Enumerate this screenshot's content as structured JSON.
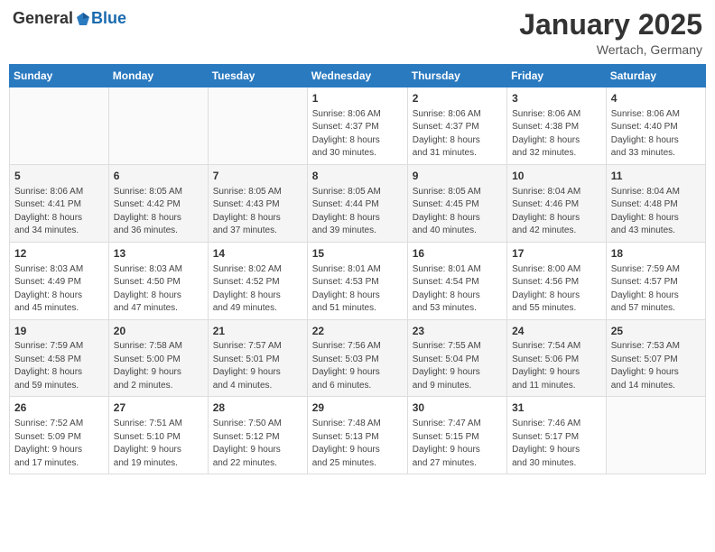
{
  "header": {
    "logo_general": "General",
    "logo_blue": "Blue",
    "month": "January 2025",
    "location": "Wertach, Germany"
  },
  "weekdays": [
    "Sunday",
    "Monday",
    "Tuesday",
    "Wednesday",
    "Thursday",
    "Friday",
    "Saturday"
  ],
  "weeks": [
    [
      {
        "day": "",
        "info": ""
      },
      {
        "day": "",
        "info": ""
      },
      {
        "day": "",
        "info": ""
      },
      {
        "day": "1",
        "info": "Sunrise: 8:06 AM\nSunset: 4:37 PM\nDaylight: 8 hours\nand 30 minutes."
      },
      {
        "day": "2",
        "info": "Sunrise: 8:06 AM\nSunset: 4:37 PM\nDaylight: 8 hours\nand 31 minutes."
      },
      {
        "day": "3",
        "info": "Sunrise: 8:06 AM\nSunset: 4:38 PM\nDaylight: 8 hours\nand 32 minutes."
      },
      {
        "day": "4",
        "info": "Sunrise: 8:06 AM\nSunset: 4:40 PM\nDaylight: 8 hours\nand 33 minutes."
      }
    ],
    [
      {
        "day": "5",
        "info": "Sunrise: 8:06 AM\nSunset: 4:41 PM\nDaylight: 8 hours\nand 34 minutes."
      },
      {
        "day": "6",
        "info": "Sunrise: 8:05 AM\nSunset: 4:42 PM\nDaylight: 8 hours\nand 36 minutes."
      },
      {
        "day": "7",
        "info": "Sunrise: 8:05 AM\nSunset: 4:43 PM\nDaylight: 8 hours\nand 37 minutes."
      },
      {
        "day": "8",
        "info": "Sunrise: 8:05 AM\nSunset: 4:44 PM\nDaylight: 8 hours\nand 39 minutes."
      },
      {
        "day": "9",
        "info": "Sunrise: 8:05 AM\nSunset: 4:45 PM\nDaylight: 8 hours\nand 40 minutes."
      },
      {
        "day": "10",
        "info": "Sunrise: 8:04 AM\nSunset: 4:46 PM\nDaylight: 8 hours\nand 42 minutes."
      },
      {
        "day": "11",
        "info": "Sunrise: 8:04 AM\nSunset: 4:48 PM\nDaylight: 8 hours\nand 43 minutes."
      }
    ],
    [
      {
        "day": "12",
        "info": "Sunrise: 8:03 AM\nSunset: 4:49 PM\nDaylight: 8 hours\nand 45 minutes."
      },
      {
        "day": "13",
        "info": "Sunrise: 8:03 AM\nSunset: 4:50 PM\nDaylight: 8 hours\nand 47 minutes."
      },
      {
        "day": "14",
        "info": "Sunrise: 8:02 AM\nSunset: 4:52 PM\nDaylight: 8 hours\nand 49 minutes."
      },
      {
        "day": "15",
        "info": "Sunrise: 8:01 AM\nSunset: 4:53 PM\nDaylight: 8 hours\nand 51 minutes."
      },
      {
        "day": "16",
        "info": "Sunrise: 8:01 AM\nSunset: 4:54 PM\nDaylight: 8 hours\nand 53 minutes."
      },
      {
        "day": "17",
        "info": "Sunrise: 8:00 AM\nSunset: 4:56 PM\nDaylight: 8 hours\nand 55 minutes."
      },
      {
        "day": "18",
        "info": "Sunrise: 7:59 AM\nSunset: 4:57 PM\nDaylight: 8 hours\nand 57 minutes."
      }
    ],
    [
      {
        "day": "19",
        "info": "Sunrise: 7:59 AM\nSunset: 4:58 PM\nDaylight: 8 hours\nand 59 minutes."
      },
      {
        "day": "20",
        "info": "Sunrise: 7:58 AM\nSunset: 5:00 PM\nDaylight: 9 hours\nand 2 minutes."
      },
      {
        "day": "21",
        "info": "Sunrise: 7:57 AM\nSunset: 5:01 PM\nDaylight: 9 hours\nand 4 minutes."
      },
      {
        "day": "22",
        "info": "Sunrise: 7:56 AM\nSunset: 5:03 PM\nDaylight: 9 hours\nand 6 minutes."
      },
      {
        "day": "23",
        "info": "Sunrise: 7:55 AM\nSunset: 5:04 PM\nDaylight: 9 hours\nand 9 minutes."
      },
      {
        "day": "24",
        "info": "Sunrise: 7:54 AM\nSunset: 5:06 PM\nDaylight: 9 hours\nand 11 minutes."
      },
      {
        "day": "25",
        "info": "Sunrise: 7:53 AM\nSunset: 5:07 PM\nDaylight: 9 hours\nand 14 minutes."
      }
    ],
    [
      {
        "day": "26",
        "info": "Sunrise: 7:52 AM\nSunset: 5:09 PM\nDaylight: 9 hours\nand 17 minutes."
      },
      {
        "day": "27",
        "info": "Sunrise: 7:51 AM\nSunset: 5:10 PM\nDaylight: 9 hours\nand 19 minutes."
      },
      {
        "day": "28",
        "info": "Sunrise: 7:50 AM\nSunset: 5:12 PM\nDaylight: 9 hours\nand 22 minutes."
      },
      {
        "day": "29",
        "info": "Sunrise: 7:48 AM\nSunset: 5:13 PM\nDaylight: 9 hours\nand 25 minutes."
      },
      {
        "day": "30",
        "info": "Sunrise: 7:47 AM\nSunset: 5:15 PM\nDaylight: 9 hours\nand 27 minutes."
      },
      {
        "day": "31",
        "info": "Sunrise: 7:46 AM\nSunset: 5:17 PM\nDaylight: 9 hours\nand 30 minutes."
      },
      {
        "day": "",
        "info": ""
      }
    ]
  ]
}
